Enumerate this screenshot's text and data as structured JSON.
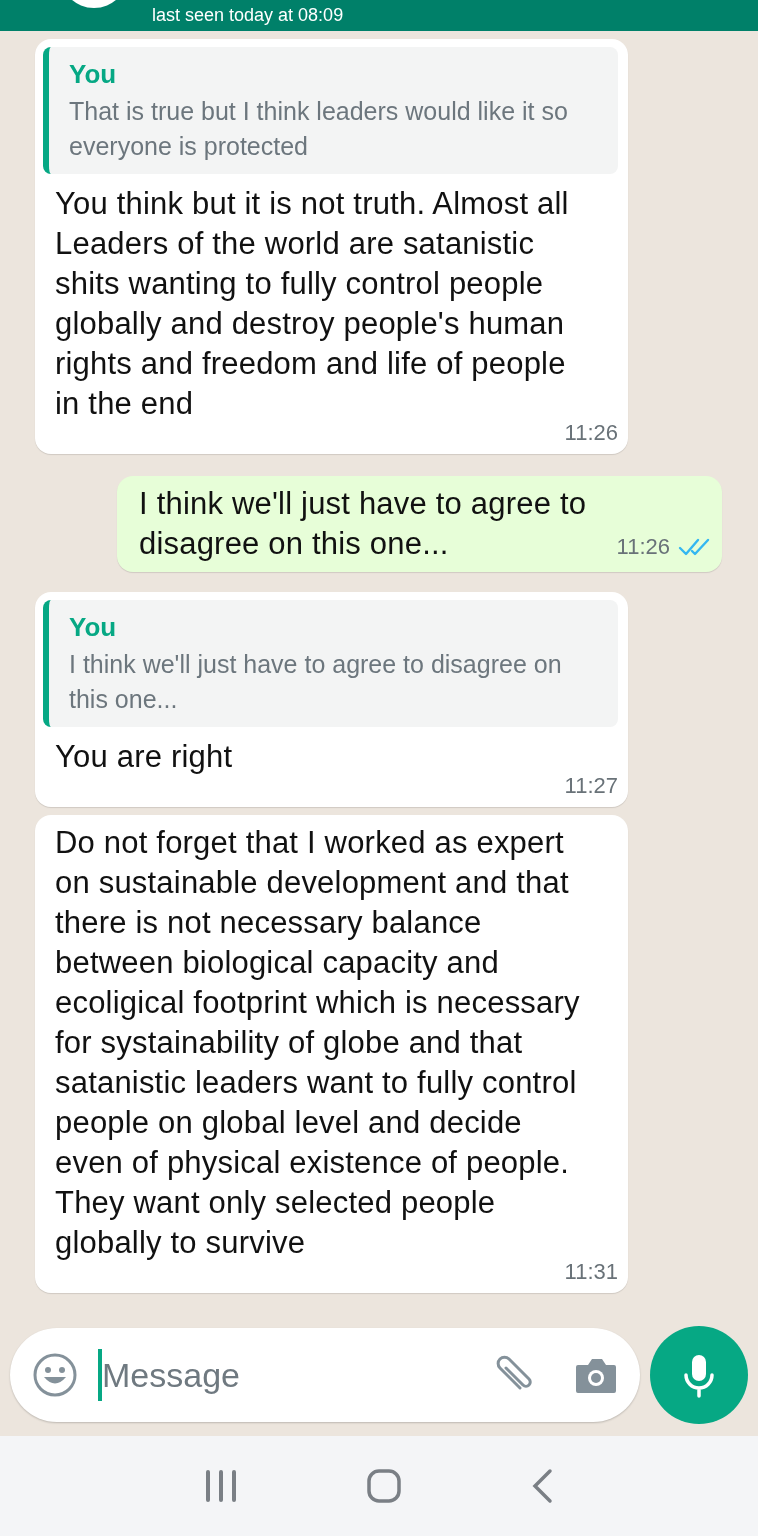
{
  "header": {
    "status": "last seen today at 08:09"
  },
  "messages": [
    {
      "outgoing": false,
      "quote": {
        "author": "You",
        "text": "That is true but I think leaders would like it so everyone is protected"
      },
      "text": "You think but it is not truth. Almost all Leaders of the world are satanistic shits wanting to fully control people globally and destroy people's human rights and freedom and life of people in the end",
      "time": "11:26"
    },
    {
      "outgoing": true,
      "text": "I think we'll just have to agree to disagree on this one...",
      "time": "11:26",
      "read": true
    },
    {
      "outgoing": false,
      "quote": {
        "author": "You",
        "text": "I think we'll just have to agree to disagree on this one..."
      },
      "text": "You are right",
      "time": "11:27"
    },
    {
      "outgoing": false,
      "text": "Do not forget that I worked as expert on sustainable development and that there is not necessary balance between biological capacity and ecoligical footprint which is necessary for systainability of globe and that satanistic leaders want to fully control people on global level and decide even of physical existence of people.  They want only selected people globally to survive",
      "time": "11:31"
    }
  ],
  "composer": {
    "placeholder": "Message"
  }
}
